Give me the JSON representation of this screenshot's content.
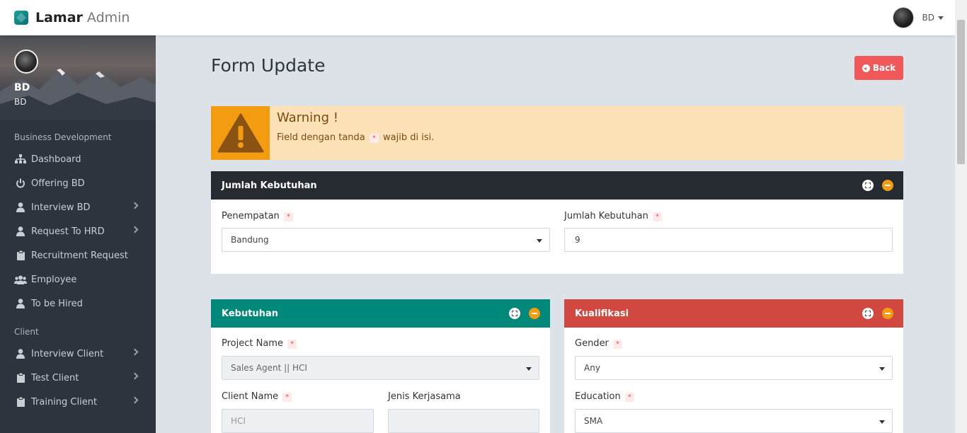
{
  "brand": {
    "name": "Lamar",
    "sub": "Admin"
  },
  "topbar": {
    "user_name": "BD"
  },
  "profile": {
    "name": "BD",
    "role": "BD"
  },
  "sidebar": {
    "section_bd": "Business Development",
    "bd_items": [
      {
        "label": "Dashboard",
        "icon": "sitemap-icon"
      },
      {
        "label": "Offering BD",
        "icon": "power-icon"
      },
      {
        "label": "Interview BD",
        "icon": "user-icon"
      },
      {
        "label": "Request To HRD",
        "icon": "user-icon"
      },
      {
        "label": "Recruitment Request",
        "icon": "clipboard-icon"
      },
      {
        "label": "Employee",
        "icon": "users-icon"
      },
      {
        "label": "To be Hired",
        "icon": "user-icon"
      }
    ],
    "section_client": "Client",
    "client_items": [
      {
        "label": "Interview Client",
        "icon": "user-icon"
      },
      {
        "label": "Test Client",
        "icon": "clipboard-icon"
      },
      {
        "label": "Training Client",
        "icon": "clipboard-icon"
      }
    ]
  },
  "page": {
    "title": "Form Update",
    "back_label": "Back"
  },
  "warning": {
    "title": "Warning !",
    "text_before": "Field dengan tanda",
    "text_after": "wajib di isi.",
    "required_mark": "*"
  },
  "panel_jumlah": {
    "title": "Jumlah Kebutuhan",
    "penempatan_label": "Penempatan",
    "penempatan_value": "Bandung",
    "jumlah_label": "Jumlah Kebutuhan",
    "jumlah_value": "9"
  },
  "panel_kebutuhan": {
    "title": "Kebutuhan",
    "project_label": "Project Name",
    "project_value": "Sales Agent || HCI",
    "client_label": "Client Name",
    "client_value": "HCI",
    "jenis_label": "Jenis Kerjasama",
    "jenis_value": ""
  },
  "panel_kualifikasi": {
    "title": "Kualifikasi",
    "gender_label": "Gender",
    "gender_value": "Any",
    "education_label": "Education",
    "education_value": "SMA"
  },
  "colors": {
    "dark_header": "#262a31",
    "teal_header": "#00897b",
    "red_header": "#d0483f",
    "warning_bg": "#fde2b8",
    "warning_icon_bg": "#f39c12",
    "back_button": "#f1585a"
  }
}
